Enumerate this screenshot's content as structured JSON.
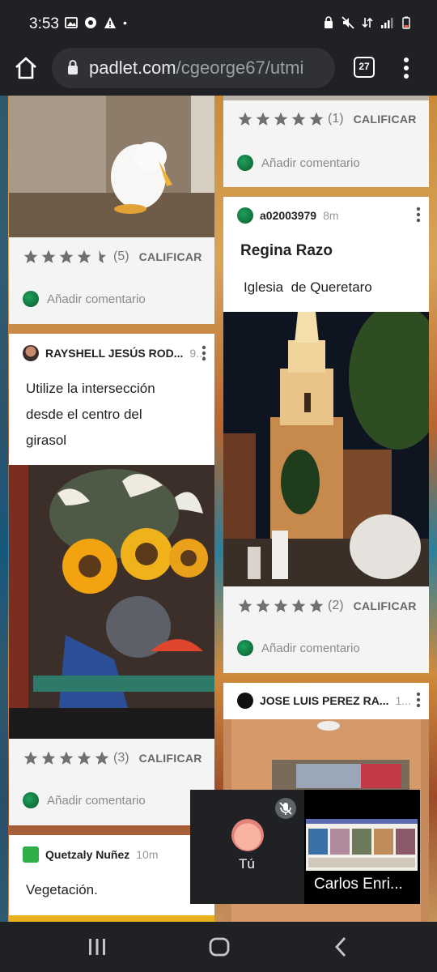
{
  "status_bar": {
    "time": "3:53",
    "dot": "•"
  },
  "browser": {
    "url_domain": "padlet.com",
    "url_path": "/cgeorge67/utmi",
    "tab_count": "27"
  },
  "cards": {
    "duck": {
      "rating_count": "(5)",
      "calificar": "CALIFICAR",
      "comment": "Añadir comentario"
    },
    "rayshell": {
      "author": "RAYSHELL JESÚS ROD...",
      "time": "9...",
      "body_lines": [
        "Utilize la intersección",
        "desde el centro del",
        "girasol"
      ],
      "rating_count": "(3)",
      "calificar": "CALIFICAR",
      "comment": "Añadir comentario"
    },
    "quetzaly": {
      "author": "Quetzaly Nuñez",
      "time": "10m",
      "body": "Vegetación."
    },
    "top_right": {
      "rating_count": "(1)",
      "calificar": "CALIFICAR",
      "comment": "Añadir comentario"
    },
    "regina": {
      "author": "a02003979",
      "time": "8m",
      "title": "Regina Razo",
      "body": "Iglesia  de Queretaro",
      "rating_count": "(2)",
      "calificar": "CALIFICAR",
      "comment": "Añadir comentario"
    },
    "jose": {
      "author": "JOSE LUIS PEREZ RA...",
      "time": "1..."
    }
  },
  "call": {
    "self_label": "Tú",
    "remote_name": "Carlos Enri..."
  },
  "colors": {
    "star": "#707070",
    "card_gray": "#f4f4f4",
    "chrome_bar": "#202124",
    "avatar_green": "#0b5a2f"
  }
}
